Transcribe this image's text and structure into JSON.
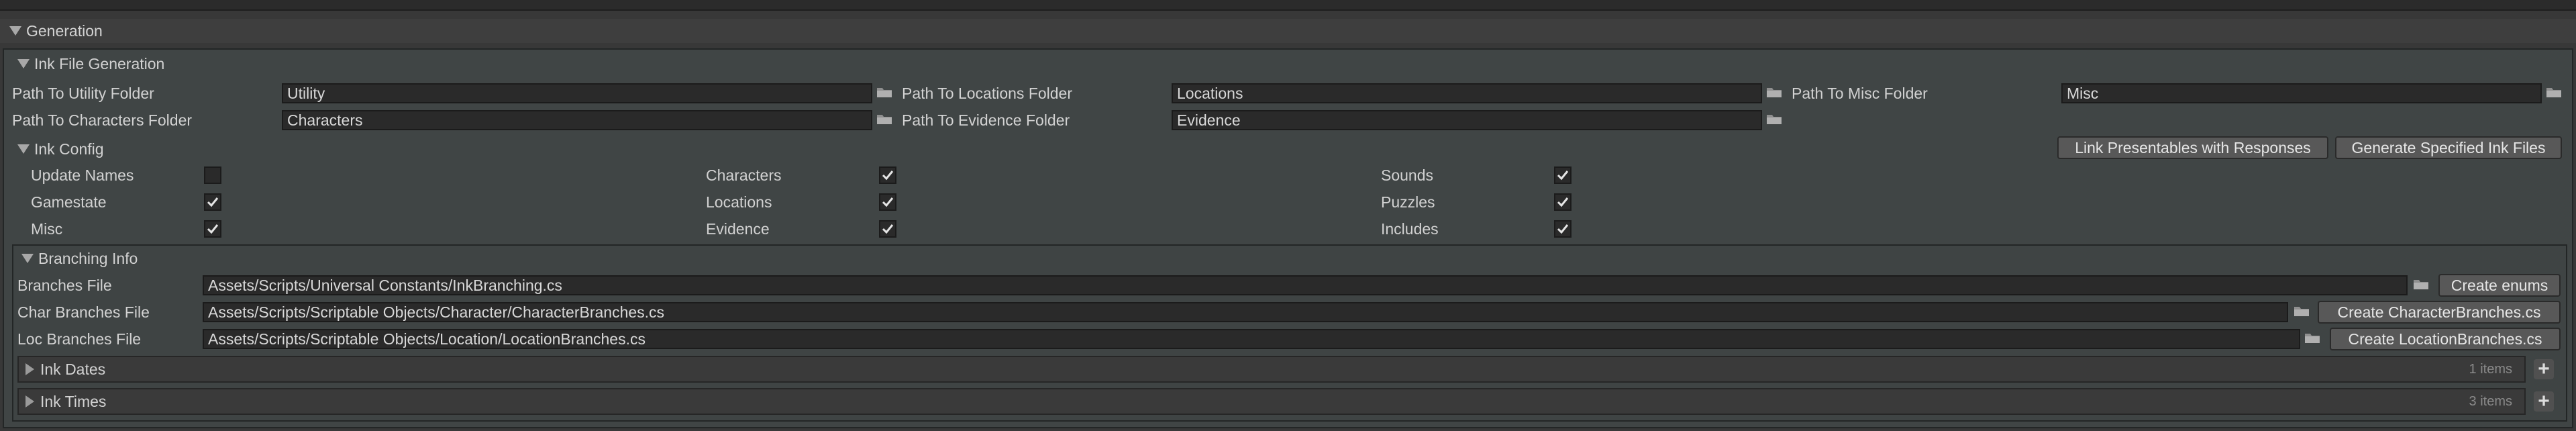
{
  "generation": {
    "title": "Generation"
  },
  "ink_file_generation": {
    "title": "Ink File Generation",
    "paths": [
      {
        "label": "Path To Utility Folder",
        "value": "Utility"
      },
      {
        "label": "Path To Locations Folder",
        "value": "Locations"
      },
      {
        "label": "Path To Misc Folder",
        "value": "Misc"
      },
      {
        "label": "Path To Characters Folder",
        "value": "Characters"
      },
      {
        "label": "Path To Evidence Folder",
        "value": "Evidence"
      }
    ]
  },
  "ink_config": {
    "title": "Ink Config",
    "buttons": {
      "link": "Link Presentables with Responses",
      "generate": "Generate Specified Ink Files"
    },
    "toggles": [
      {
        "label": "Update Names",
        "checked": false
      },
      {
        "label": "Characters",
        "checked": true
      },
      {
        "label": "Sounds",
        "checked": true
      },
      {
        "label": "Gamestate",
        "checked": true
      },
      {
        "label": "Locations",
        "checked": true
      },
      {
        "label": "Puzzles",
        "checked": true
      },
      {
        "label": "Misc",
        "checked": true
      },
      {
        "label": "Evidence",
        "checked": true
      },
      {
        "label": "Includes",
        "checked": true
      }
    ]
  },
  "branching_info": {
    "title": "Branching Info",
    "rows": [
      {
        "label": "Branches File",
        "value": "Assets/Scripts/Universal Constants/InkBranching.cs",
        "button": "Create enums"
      },
      {
        "label": "Char Branches File",
        "value": "Assets/Scripts/Scriptable Objects/Character/CharacterBranches.cs",
        "button": "Create CharacterBranches.cs"
      },
      {
        "label": "Loc Branches File",
        "value": "Assets/Scripts/Scriptable Objects/Location/LocationBranches.cs",
        "button": "Create LocationBranches.cs"
      }
    ],
    "lists": [
      {
        "label": "Ink Dates",
        "count": "1 items"
      },
      {
        "label": "Ink Times",
        "count": "3 items"
      }
    ]
  },
  "icons": {
    "folder": "folder-icon",
    "checkmark": "checkmark-icon",
    "foldout": "triangle-icon",
    "add": "plus-icon"
  },
  "colors": {
    "background": "#383838",
    "panel": "#404545",
    "field": "#2a2a2a",
    "button": "#585858",
    "text": "#d2d2d2"
  }
}
